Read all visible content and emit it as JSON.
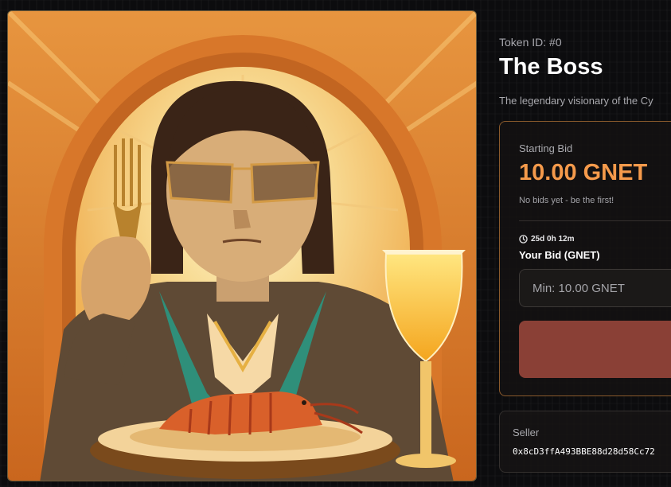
{
  "artwork": {
    "subject": "portrait-painting",
    "palette": [
      "#f3c16b",
      "#e07a2a",
      "#2f8f7a",
      "#d9602a"
    ]
  },
  "token": {
    "id_label": "Token ID: #0",
    "title": "The Boss",
    "description": "The legendary visionary of the Cy"
  },
  "bid_card": {
    "starting_bid_label": "Starting Bid",
    "starting_bid_value": "10.00 GNET",
    "status_text": "No bids yet - be the first!",
    "timer_icon": "clock-icon",
    "timer_text": "25d 0h 12m",
    "your_bid_label": "Your Bid (GNET)",
    "input_placeholder": "Min: 10.00 GNET",
    "input_value": "",
    "button_label": "",
    "accent_color": "#f59a4b",
    "button_color": "#8a4036"
  },
  "seller": {
    "label": "Seller",
    "address": "0x8cD3ffA493BBE88d28d58Cc72"
  }
}
